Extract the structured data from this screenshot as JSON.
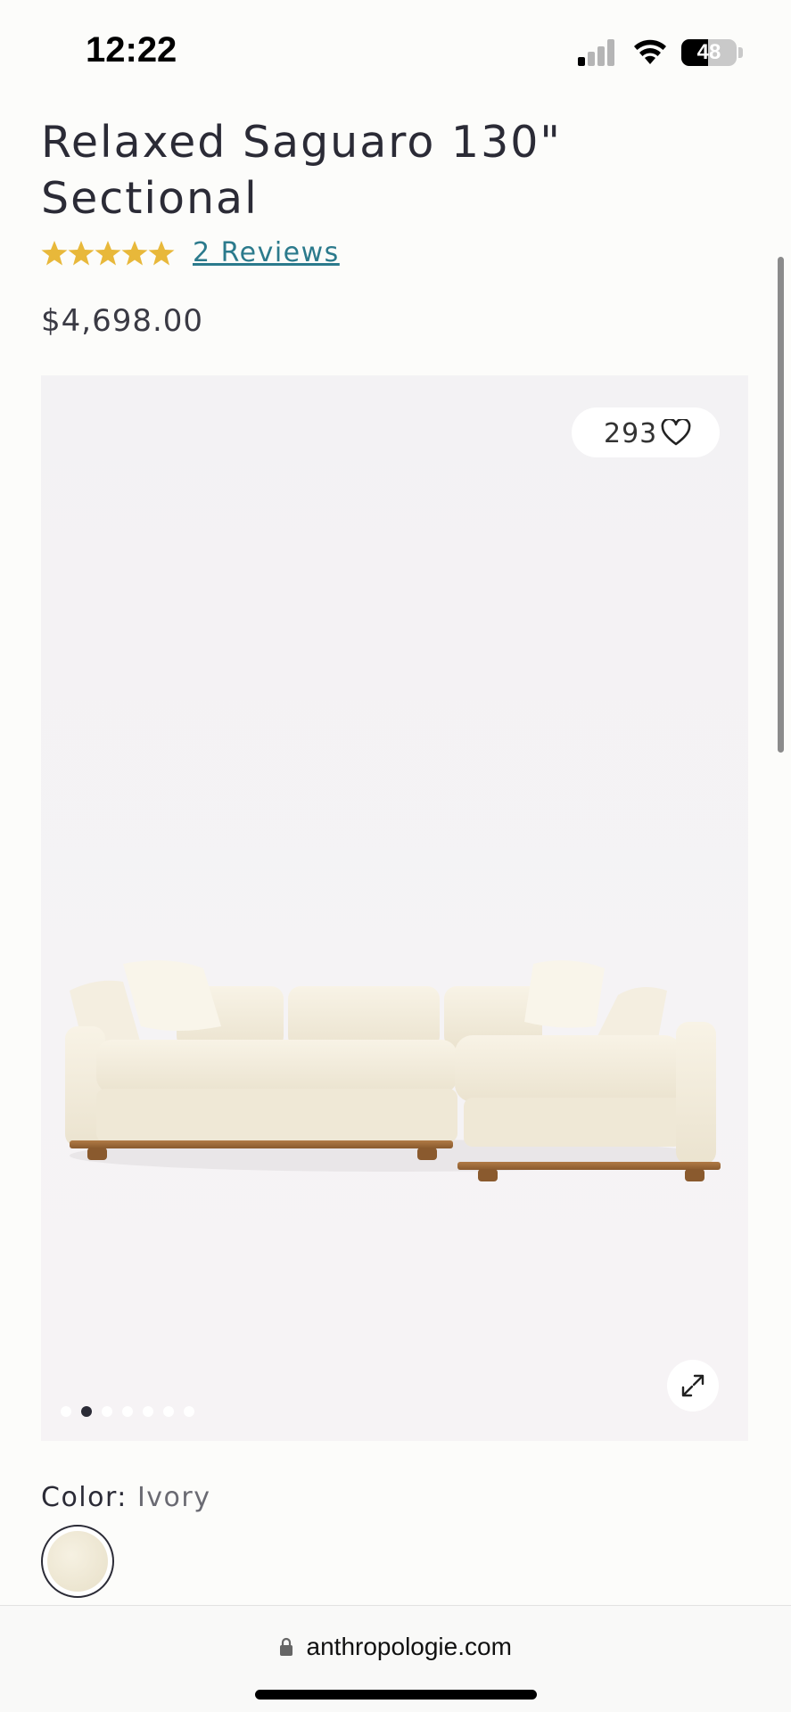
{
  "status_bar": {
    "time": "12:22",
    "battery": "48",
    "battery_level": 0.48
  },
  "product": {
    "title": "Relaxed Saguaro 130\" Sectional",
    "rating": 5,
    "reviews_label": "2 Reviews",
    "price": "$4,698.00"
  },
  "gallery": {
    "likes": "293",
    "image_count": 7,
    "active_index": 1,
    "icons": [
      "heart-icon",
      "expand-icon"
    ]
  },
  "color": {
    "label": "Color:",
    "value": "Ivory",
    "swatch_color": "#efe8d4"
  },
  "browser": {
    "url": "anthropologie.com"
  },
  "colors": {
    "accent_link": "#2b7a8c",
    "star": "#e8b83a",
    "text": "#2b2b36"
  }
}
